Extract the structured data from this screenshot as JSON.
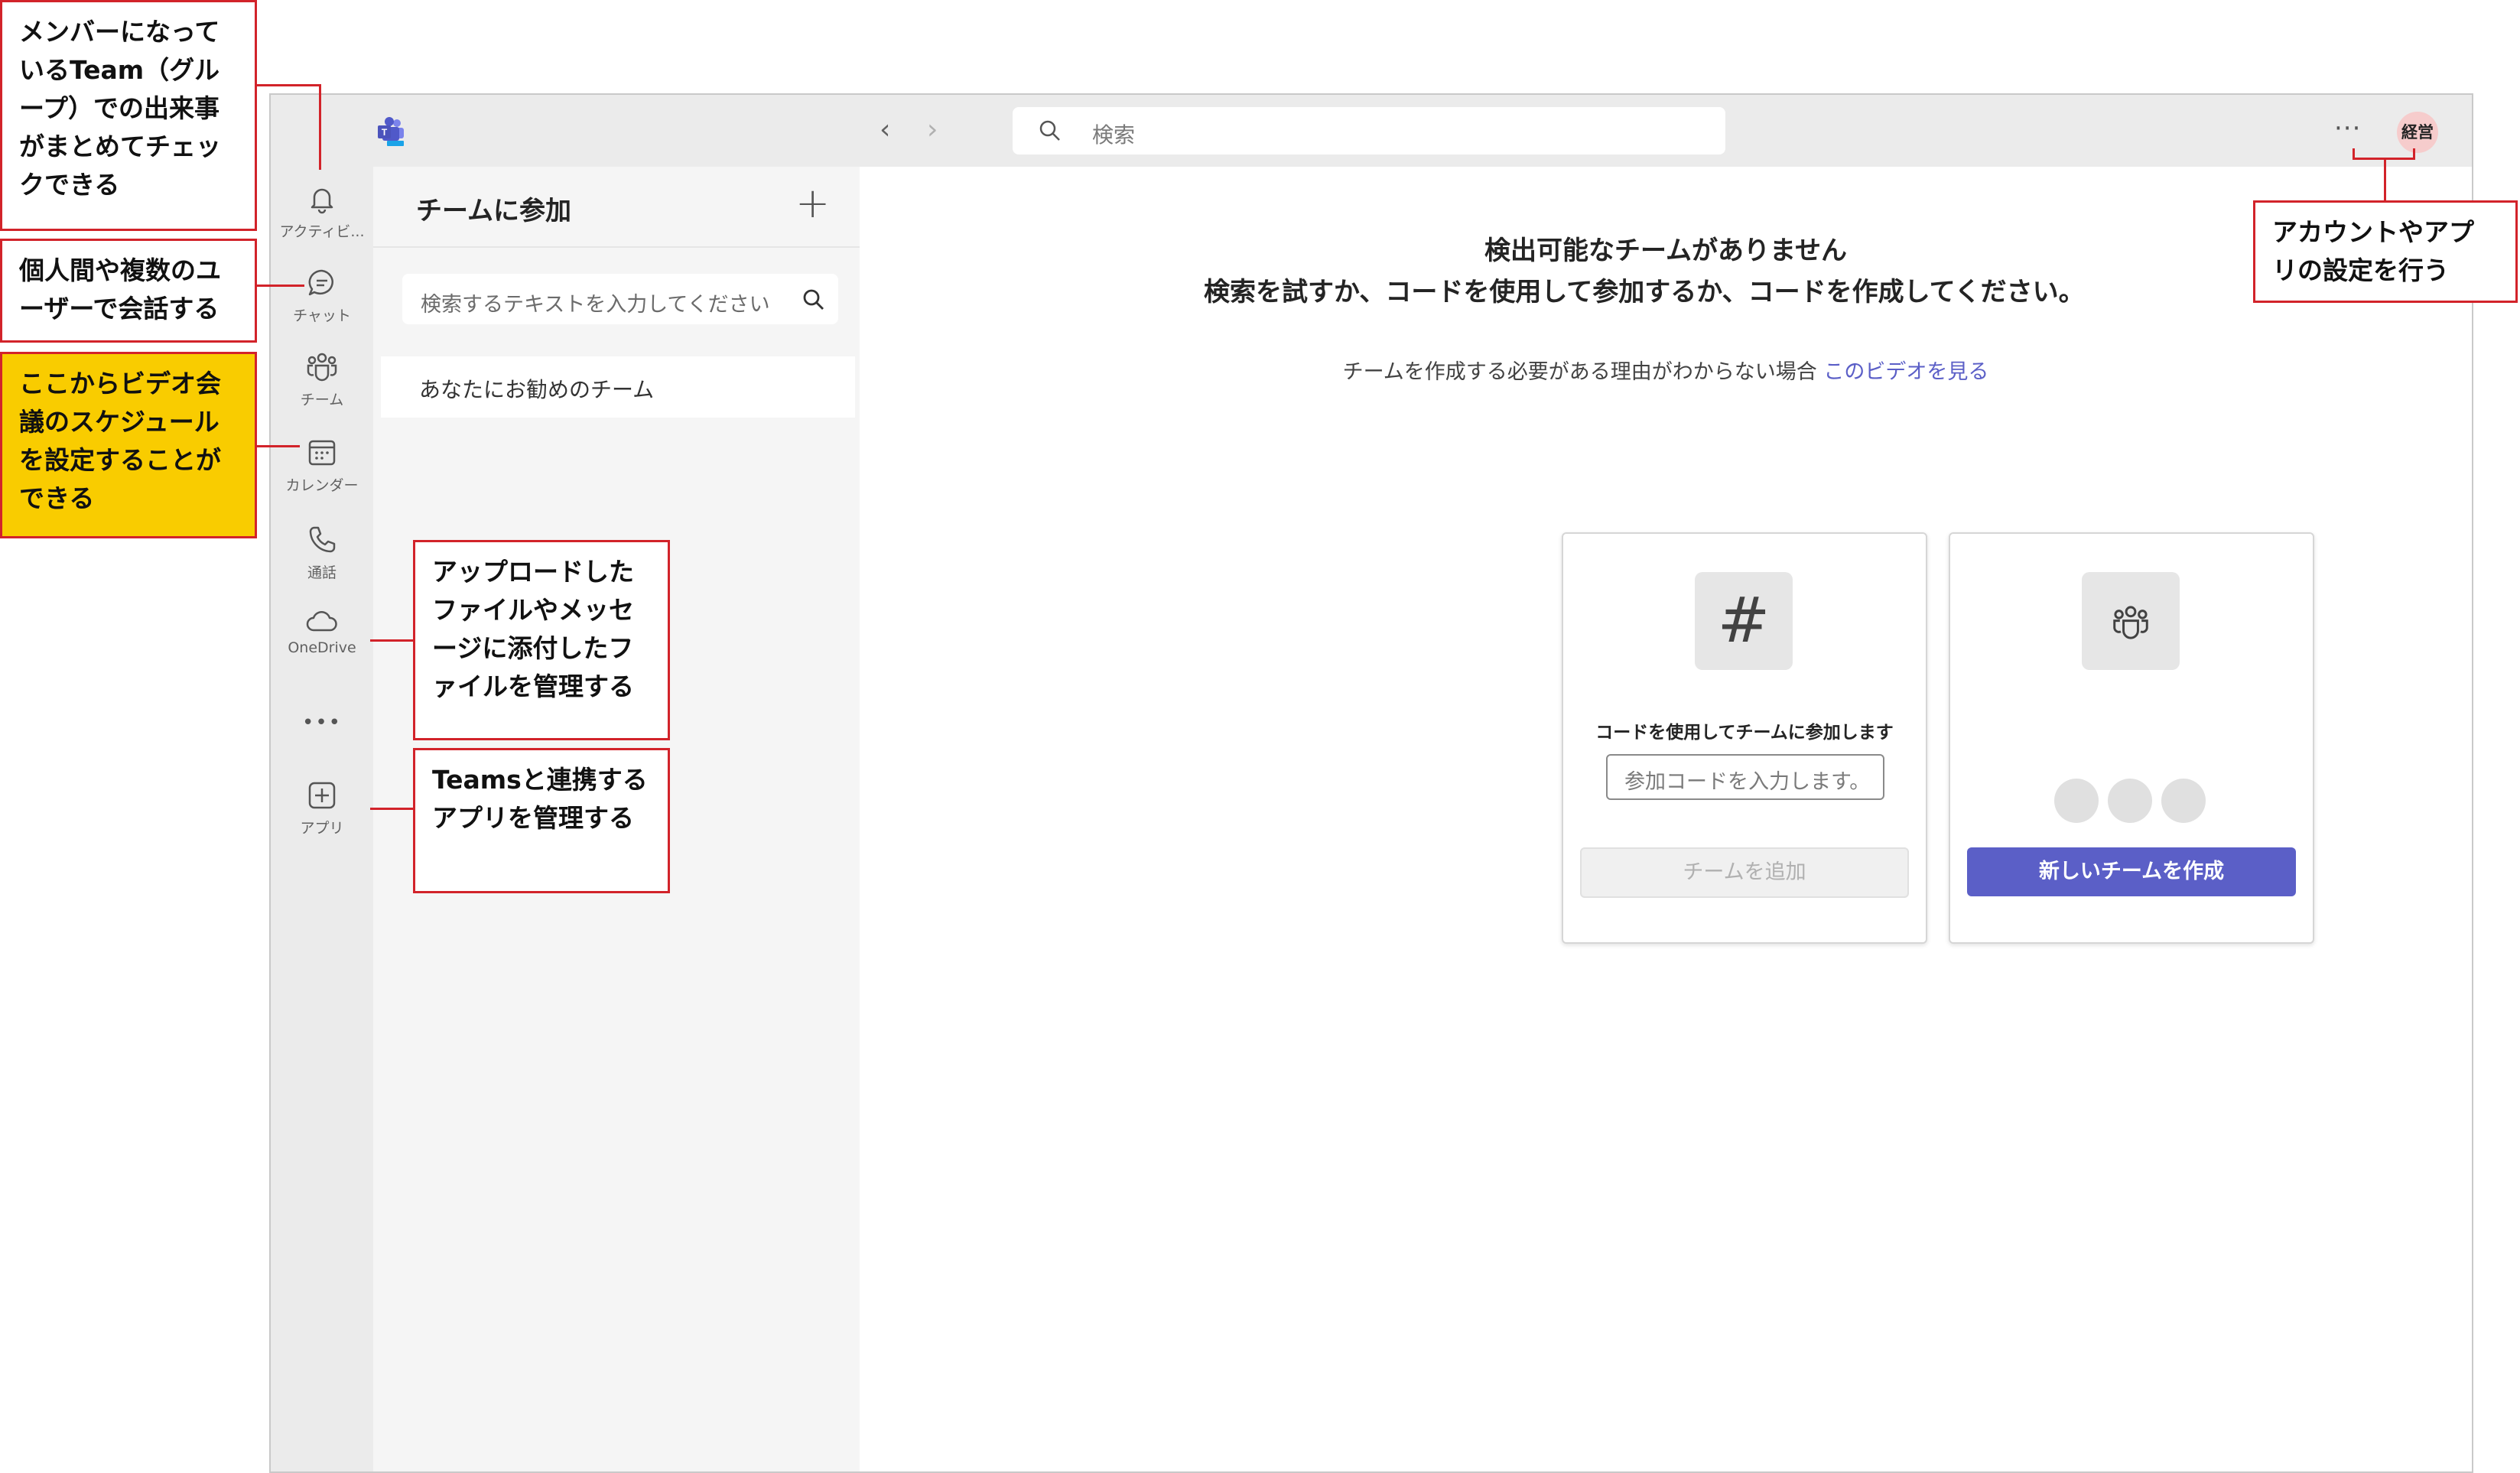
{
  "titlebar": {
    "search_placeholder": "検索",
    "more_label": "···",
    "avatar_text": "経営"
  },
  "rail": {
    "items": [
      {
        "icon": "bell-icon",
        "label": "アクティビ..."
      },
      {
        "icon": "chat-icon",
        "label": "チャット"
      },
      {
        "icon": "teams-icon",
        "label": "チーム"
      },
      {
        "icon": "calendar-icon",
        "label": "カレンダー"
      },
      {
        "icon": "phone-icon",
        "label": "通話"
      },
      {
        "icon": "cloud-icon",
        "label": "OneDrive"
      },
      {
        "icon": "ellipsis-icon",
        "label": "•••"
      },
      {
        "icon": "plus-square-icon",
        "label": "アプリ"
      }
    ]
  },
  "panel": {
    "title": "チームに参加",
    "plus": "+",
    "search_placeholder": "検索するテキストを入力してください",
    "recommended": "あなたにお勧めのチーム"
  },
  "main": {
    "heading": "検出可能なチームがありません",
    "body": "検索を試すか、コードを使用して参加するか、コードを作成してください。",
    "sub_text": "チームを作成する必要がある理由がわからない場合",
    "sub_link": "このビデオを見る",
    "join_card": {
      "icon_glyph": "#",
      "label": "コードを使用してチームに参加します",
      "code_placeholder": "参加コードを入力します。",
      "button": "チームを追加"
    },
    "create_card": {
      "button": "新しいチームを作成"
    }
  },
  "annotations": {
    "activity": "メンバーになっているTeam（グループ）での出来事がまとめてチェックできる",
    "chat": "個人間や複数のユーザーで会話する",
    "calendar": "ここからビデオ会議のスケジュールを設定することができる",
    "onedrive": "アップロードしたファイルやメッセージに添付したファイルを管理する",
    "apps": "Teamsと連携するアプリを管理する",
    "account": "アカウントやアプリの設定を行う"
  },
  "colors": {
    "accent": "#5b5fc7",
    "annotation_border": "#d2232a",
    "highlight": "#f9cc00"
  }
}
